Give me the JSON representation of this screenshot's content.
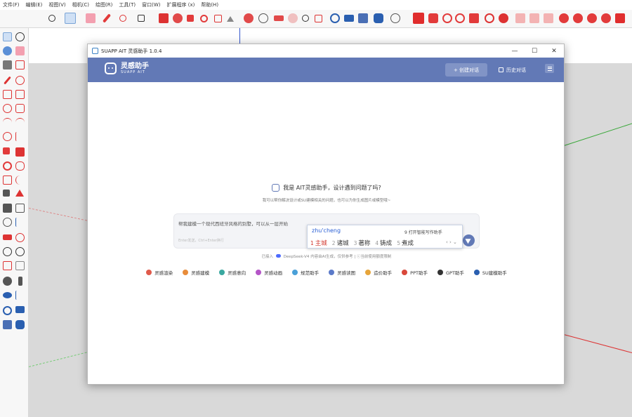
{
  "menubar": {
    "items": [
      "文件(F)",
      "编辑(E)",
      "视图(V)",
      "相机(C)",
      "绘图(R)",
      "工具(T)",
      "窗口(W)",
      "扩展程序 (x)",
      "帮助(H)"
    ]
  },
  "dialog": {
    "title": "SUAPP AIT 灵感助手 1.0.4",
    "window_buttons": [
      "—",
      "☐",
      "✕"
    ],
    "logo_cn": "灵感助手",
    "logo_en": "SUAPP AIT",
    "new_chat": "+ 创建对话",
    "history": "历史对话",
    "greeting": "我是 AIT灵感助手，设计遇到问题了吗?",
    "subgreeting": "我可以帮你解决设计或SU建模相关的问题，也可以为你生成图片或模型哦~",
    "input_text": "帮我建模一个现代西班牙风格的別墅，可以从一层开始",
    "input_hint": "Enter发送，Ctrl+Enter换行",
    "model_prefix": "已接入",
    "model_name": "DeepSeek-V4",
    "model_suffix": "内容由AI生成，仅供参考  |  ⓒ当前使用额度限制",
    "tools": [
      {
        "label": "灵感渲染",
        "color": "#e05a4b"
      },
      {
        "label": "灵感建模",
        "color": "#e88c3a"
      },
      {
        "label": "灵感意向",
        "color": "#3aa8a0"
      },
      {
        "label": "灵感动画",
        "color": "#b455c7"
      },
      {
        "label": "规范助手",
        "color": "#4aa0d8"
      },
      {
        "label": "灵感读图",
        "color": "#5b7ac9"
      },
      {
        "label": "造价助手",
        "color": "#e7a53a"
      },
      {
        "label": "PPT助手",
        "color": "#d9483b"
      },
      {
        "label": "GPT助手",
        "color": "#333333"
      },
      {
        "label": "SU建模助手",
        "color": "#2a5fb0"
      }
    ]
  },
  "ime": {
    "pinyin": "zhu'cheng",
    "tip": "9 打开智能写作助手",
    "candidates": [
      {
        "num": "1",
        "text": "主城"
      },
      {
        "num": "2",
        "text": "诸城"
      },
      {
        "num": "3",
        "text": "著称"
      },
      {
        "num": "4",
        "text": "铸成"
      },
      {
        "num": "5",
        "text": "煮成"
      }
    ],
    "arrows": "‹  ›  ⌄"
  }
}
